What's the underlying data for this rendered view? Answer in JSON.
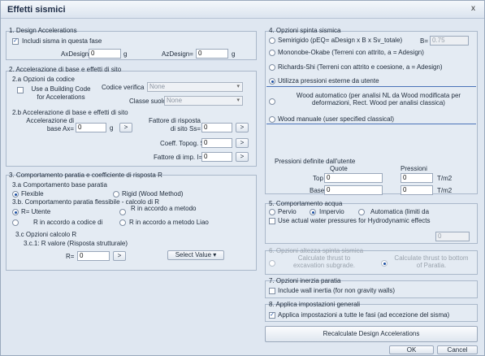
{
  "window": {
    "title": "Effetti sismici",
    "close": "x"
  },
  "s1": {
    "title": "1. Design Accelerations",
    "include_sisma": "Includi sisma in questa fase",
    "axdesign_label": "AxDesign",
    "axdesign_value": "0",
    "azdesign_label": "AzDesign=",
    "azdesign_value": "0",
    "unit_g": "g"
  },
  "s2": {
    "title": "2. Accelerazione di base e effetti di sito",
    "a_title": "2.a Opzioni da codice",
    "use_code": "Use a Building Code for Accelerations",
    "codice_verifica_label": "Codice verifica",
    "codice_verifica_value": "None",
    "classe_suolo_label": "Classe suolo",
    "classe_suolo_value": "None",
    "b_title": "2.b Accelerazione di base e effetti di sito",
    "acc_label": "Accelerazione di base Ax=",
    "acc_value": "0",
    "acc_unit": "g",
    "arrow": ">",
    "fattore_risposta_label": "Fattore di risposta di sito Ss=",
    "fattore_risposta_value": "0",
    "coeff_topog_label": "Coeff. Topog. St=",
    "coeff_topog_value": "0",
    "fattore_imp_label": "Fattore di imp. I=",
    "fattore_imp_value": "0"
  },
  "s3": {
    "title": "3. Comportamento paratia e coefficiente di risposta R",
    "a_title": "3.a Comportamento base paratia",
    "flexible": "Flexible",
    "rigid": "Rigid (Wood Method)",
    "b_title": "3.b. Comportamento paratia flessibile - calcolo di R",
    "r_utente": "R= Utente",
    "r_metodo": "R in accordo a metodo",
    "r_codice": "R in accordo a codice di",
    "r_liao": "R in accordo a metodo Liao",
    "c_title": "3.c Opzioni calcolo R",
    "c1_title": "3.c.1: R valore (Risposta strutturale)",
    "r_label": "R=",
    "r_value": "0",
    "select_value": "Select Value"
  },
  "s4": {
    "title": "4. Opzioni spinta sismica",
    "seminigido": "Semirigido (pEQ= aDesign x B x Sv_totale)",
    "beta_label": "B=",
    "beta_value": "0.75",
    "mononobe": "Mononobe-Okabe (Terreni con attrito, a = Adesign)",
    "richards": "Richards-Shi (Terreni con attrito e coesione, a = Adesign)",
    "utilizza": "Utilizza pressioni esterne da utente",
    "wood_auto": "Wood automatico (per analisi NL da Wood modificata per deformazioni, Rect. Wood per analisi classica)",
    "wood_manual": "Wood manuale (user specified classical)",
    "pressioni_title": "Pressioni definite dall'utente",
    "quote_header": "Quote",
    "pressioni_header": "Pressioni",
    "top_label": "Top",
    "top_quote": "0",
    "top_press": "0",
    "base_label": "Base",
    "base_quote": "0",
    "base_press": "0",
    "unit": "T/m2"
  },
  "s5": {
    "title": "5. Comportamento acqua",
    "pervio": "Pervio",
    "impervio": "Impervio",
    "automatica": "Automatica (limiti da",
    "use_actual": "Use actual water pressures for Hydrodynamic effects",
    "value": "0"
  },
  "s6": {
    "title": "6. Opzioni altezza spinta sismica",
    "calc_subgrade": "Calculate thrust to excavation subgrade.",
    "calc_bottom": "Calculate thrust to bottom of Paratia."
  },
  "s7": {
    "title": "7. Opzioni inerzia paratia",
    "include_wall": "Include wall inertia (for non gravity walls)"
  },
  "s8": {
    "title": "8. Applica impostazioni generali",
    "applica": "Applica impostazioni a tutte le fasi (ad eccezione del sisma)"
  },
  "footer": {
    "recalc": "Recalculate Design Accelerations",
    "ok": "OK",
    "cancel": "Cancel"
  }
}
